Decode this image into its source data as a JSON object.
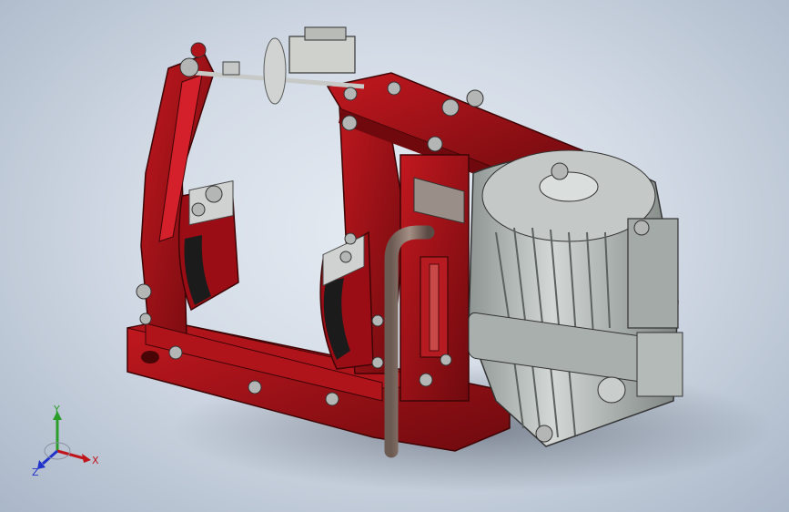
{
  "viewport": {
    "background_top": "#e6ecf3",
    "background_bottom": "#aab7c8",
    "model_color": "#9b0d14",
    "motor_color": "#b9bfbd",
    "bolt_color": "#b3b6b4"
  },
  "triad": {
    "x_label": "X",
    "y_label": "Y",
    "z_label": "Z",
    "x_color": "#c0151a",
    "y_color": "#2a9d2a",
    "z_color": "#2233cc"
  }
}
